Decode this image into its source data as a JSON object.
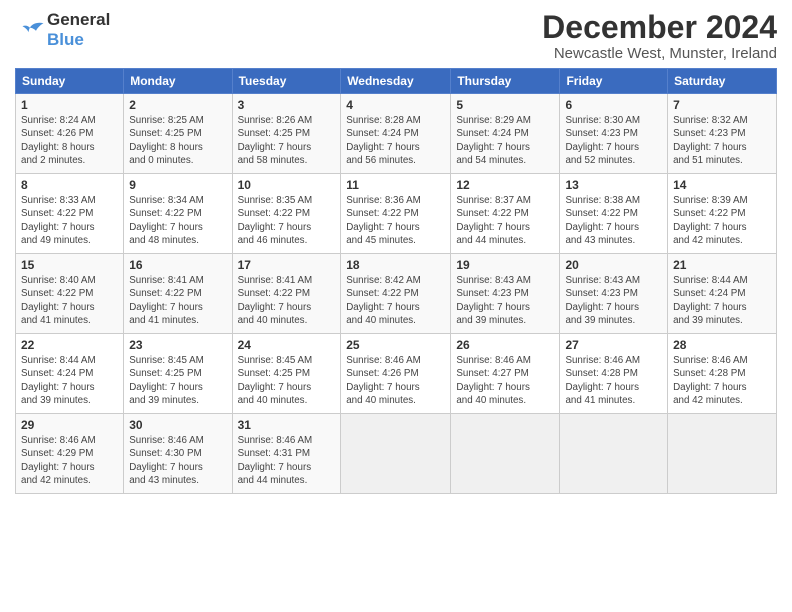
{
  "header": {
    "logo_general": "General",
    "logo_blue": "Blue",
    "title": "December 2024",
    "subtitle": "Newcastle West, Munster, Ireland"
  },
  "calendar": {
    "days_of_week": [
      "Sunday",
      "Monday",
      "Tuesday",
      "Wednesday",
      "Thursday",
      "Friday",
      "Saturday"
    ],
    "weeks": [
      [
        null,
        {
          "day": 2,
          "sunrise": "8:25 AM",
          "sunset": "4:25 PM",
          "daylight": "8 hours and 0 minutes"
        },
        {
          "day": 3,
          "sunrise": "8:26 AM",
          "sunset": "4:25 PM",
          "daylight": "7 hours and 58 minutes"
        },
        {
          "day": 4,
          "sunrise": "8:28 AM",
          "sunset": "4:24 PM",
          "daylight": "7 hours and 56 minutes"
        },
        {
          "day": 5,
          "sunrise": "8:29 AM",
          "sunset": "4:24 PM",
          "daylight": "7 hours and 54 minutes"
        },
        {
          "day": 6,
          "sunrise": "8:30 AM",
          "sunset": "4:23 PM",
          "daylight": "7 hours and 52 minutes"
        },
        {
          "day": 7,
          "sunrise": "8:32 AM",
          "sunset": "4:23 PM",
          "daylight": "7 hours and 51 minutes"
        }
      ],
      [
        {
          "day": 1,
          "sunrise": "8:24 AM",
          "sunset": "4:26 PM",
          "daylight": "8 hours and 2 minutes"
        },
        {
          "day": 9,
          "sunrise": "8:34 AM",
          "sunset": "4:22 PM",
          "daylight": "7 hours and 48 minutes"
        },
        {
          "day": 10,
          "sunrise": "8:35 AM",
          "sunset": "4:22 PM",
          "daylight": "7 hours and 46 minutes"
        },
        {
          "day": 11,
          "sunrise": "8:36 AM",
          "sunset": "4:22 PM",
          "daylight": "7 hours and 45 minutes"
        },
        {
          "day": 12,
          "sunrise": "8:37 AM",
          "sunset": "4:22 PM",
          "daylight": "7 hours and 44 minutes"
        },
        {
          "day": 13,
          "sunrise": "8:38 AM",
          "sunset": "4:22 PM",
          "daylight": "7 hours and 43 minutes"
        },
        {
          "day": 14,
          "sunrise": "8:39 AM",
          "sunset": "4:22 PM",
          "daylight": "7 hours and 42 minutes"
        }
      ],
      [
        {
          "day": 8,
          "sunrise": "8:33 AM",
          "sunset": "4:22 PM",
          "daylight": "7 hours and 49 minutes"
        },
        {
          "day": 16,
          "sunrise": "8:41 AM",
          "sunset": "4:22 PM",
          "daylight": "7 hours and 41 minutes"
        },
        {
          "day": 17,
          "sunrise": "8:41 AM",
          "sunset": "4:22 PM",
          "daylight": "7 hours and 40 minutes"
        },
        {
          "day": 18,
          "sunrise": "8:42 AM",
          "sunset": "4:22 PM",
          "daylight": "7 hours and 40 minutes"
        },
        {
          "day": 19,
          "sunrise": "8:43 AM",
          "sunset": "4:23 PM",
          "daylight": "7 hours and 39 minutes"
        },
        {
          "day": 20,
          "sunrise": "8:43 AM",
          "sunset": "4:23 PM",
          "daylight": "7 hours and 39 minutes"
        },
        {
          "day": 21,
          "sunrise": "8:44 AM",
          "sunset": "4:24 PM",
          "daylight": "7 hours and 39 minutes"
        }
      ],
      [
        {
          "day": 15,
          "sunrise": "8:40 AM",
          "sunset": "4:22 PM",
          "daylight": "7 hours and 41 minutes"
        },
        {
          "day": 23,
          "sunrise": "8:45 AM",
          "sunset": "4:25 PM",
          "daylight": "7 hours and 39 minutes"
        },
        {
          "day": 24,
          "sunrise": "8:45 AM",
          "sunset": "4:25 PM",
          "daylight": "7 hours and 40 minutes"
        },
        {
          "day": 25,
          "sunrise": "8:46 AM",
          "sunset": "4:26 PM",
          "daylight": "7 hours and 40 minutes"
        },
        {
          "day": 26,
          "sunrise": "8:46 AM",
          "sunset": "4:27 PM",
          "daylight": "7 hours and 40 minutes"
        },
        {
          "day": 27,
          "sunrise": "8:46 AM",
          "sunset": "4:28 PM",
          "daylight": "7 hours and 41 minutes"
        },
        {
          "day": 28,
          "sunrise": "8:46 AM",
          "sunset": "4:28 PM",
          "daylight": "7 hours and 42 minutes"
        }
      ],
      [
        {
          "day": 22,
          "sunrise": "8:44 AM",
          "sunset": "4:24 PM",
          "daylight": "7 hours and 39 minutes"
        },
        {
          "day": 30,
          "sunrise": "8:46 AM",
          "sunset": "4:30 PM",
          "daylight": "7 hours and 43 minutes"
        },
        {
          "day": 31,
          "sunrise": "8:46 AM",
          "sunset": "4:31 PM",
          "daylight": "7 hours and 44 minutes"
        },
        null,
        null,
        null,
        null
      ],
      [
        {
          "day": 29,
          "sunrise": "8:46 AM",
          "sunset": "4:29 PM",
          "daylight": "7 hours and 42 minutes"
        },
        null,
        null,
        null,
        null,
        null,
        null
      ]
    ]
  }
}
